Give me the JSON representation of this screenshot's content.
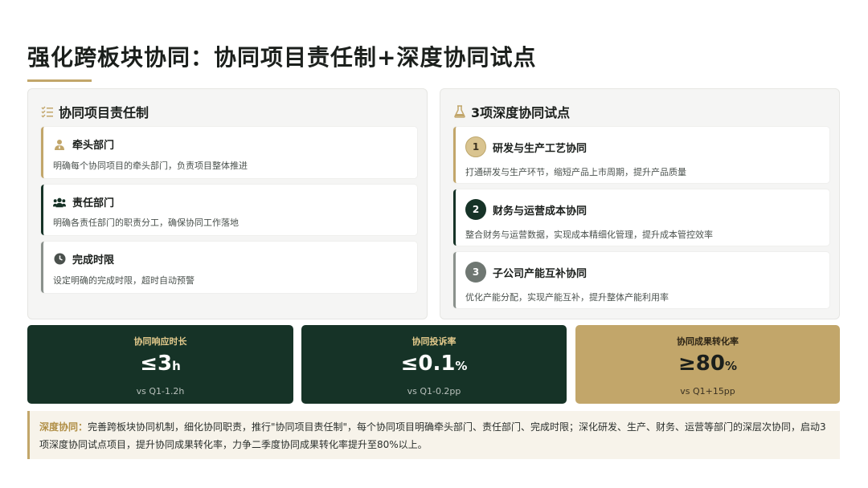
{
  "title": "强化跨板块协同：协同项目责任制+深度协同试点",
  "left_panel": {
    "heading": "协同项目责任制",
    "heading_icon": "checklist-icon",
    "items": [
      {
        "title": "牵头部门",
        "desc": "明确每个协同项目的牵头部门，负责项目整体推进",
        "icon": "person-tie-icon"
      },
      {
        "title": "责任部门",
        "desc": "明确各责任部门的职责分工，确保协同工作落地",
        "icon": "users-icon"
      },
      {
        "title": "完成时限",
        "desc": "设定明确的完成时限，超时自动预警",
        "icon": "clock-icon"
      }
    ]
  },
  "right_panel": {
    "heading": "3项深度协同试点",
    "heading_icon": "flask-icon",
    "items": [
      {
        "num": "1",
        "title": "研发与生产工艺协同",
        "desc": "打通研发与生产环节，缩短产品上市周期，提升产品质量"
      },
      {
        "num": "2",
        "title": "财务与运营成本协同",
        "desc": "整合财务与运营数据，实现成本精细化管理，提升成本管控效率"
      },
      {
        "num": "3",
        "title": "子公司产能互补协同",
        "desc": "优化产能分配，实现产能互补，提升整体产能利用率"
      }
    ]
  },
  "kpis": [
    {
      "label": "协同响应时长",
      "value": "≤3",
      "unit": "h",
      "sub": "vs Q1-1.2h"
    },
    {
      "label": "协同投诉率",
      "value": "≤0.1",
      "unit": "%",
      "sub": "vs Q1-0.2pp"
    },
    {
      "label": "协同成果转化率",
      "value": "≥80",
      "unit": "%",
      "sub": "vs Q1+15pp"
    }
  ],
  "summary": {
    "lead": "深度协同：",
    "text": "完善跨板块协同机制，细化协同职责，推行\"协同项目责任制\"，每个协同项目明确牵头部门、责任部门、完成时限；深化研发、生产、财务、运营等部门的深层次协同，启动3项深度协同试点项目，提升协同成果转化率，力争二季度协同成果转化率提升至80%以上。"
  },
  "colors": {
    "accent_gold": "#c2a66a",
    "dark_green": "#163327",
    "grey": "#6f7772"
  }
}
